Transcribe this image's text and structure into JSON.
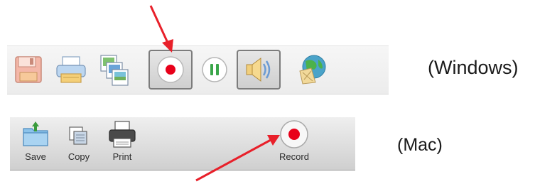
{
  "windows": {
    "platform_label": "(Windows)",
    "buttons": [
      "save",
      "print",
      "copy",
      "record",
      "pause",
      "volume",
      "map"
    ]
  },
  "mac": {
    "platform_label": "(Mac)",
    "save_label": "Save",
    "copy_label": "Copy",
    "print_label": "Print",
    "record_label": "Record"
  },
  "colors": {
    "record_red": "#e8001a",
    "arrow_red": "#e8202a",
    "pause_green": "#3aa64a"
  },
  "icons": [
    "floppy-disk-icon",
    "printer-icon",
    "copy-images-icon",
    "record-icon",
    "pause-icon",
    "speaker-icon",
    "globe-map-icon",
    "folder-save-icon",
    "copy-icon",
    "printer-icon"
  ]
}
